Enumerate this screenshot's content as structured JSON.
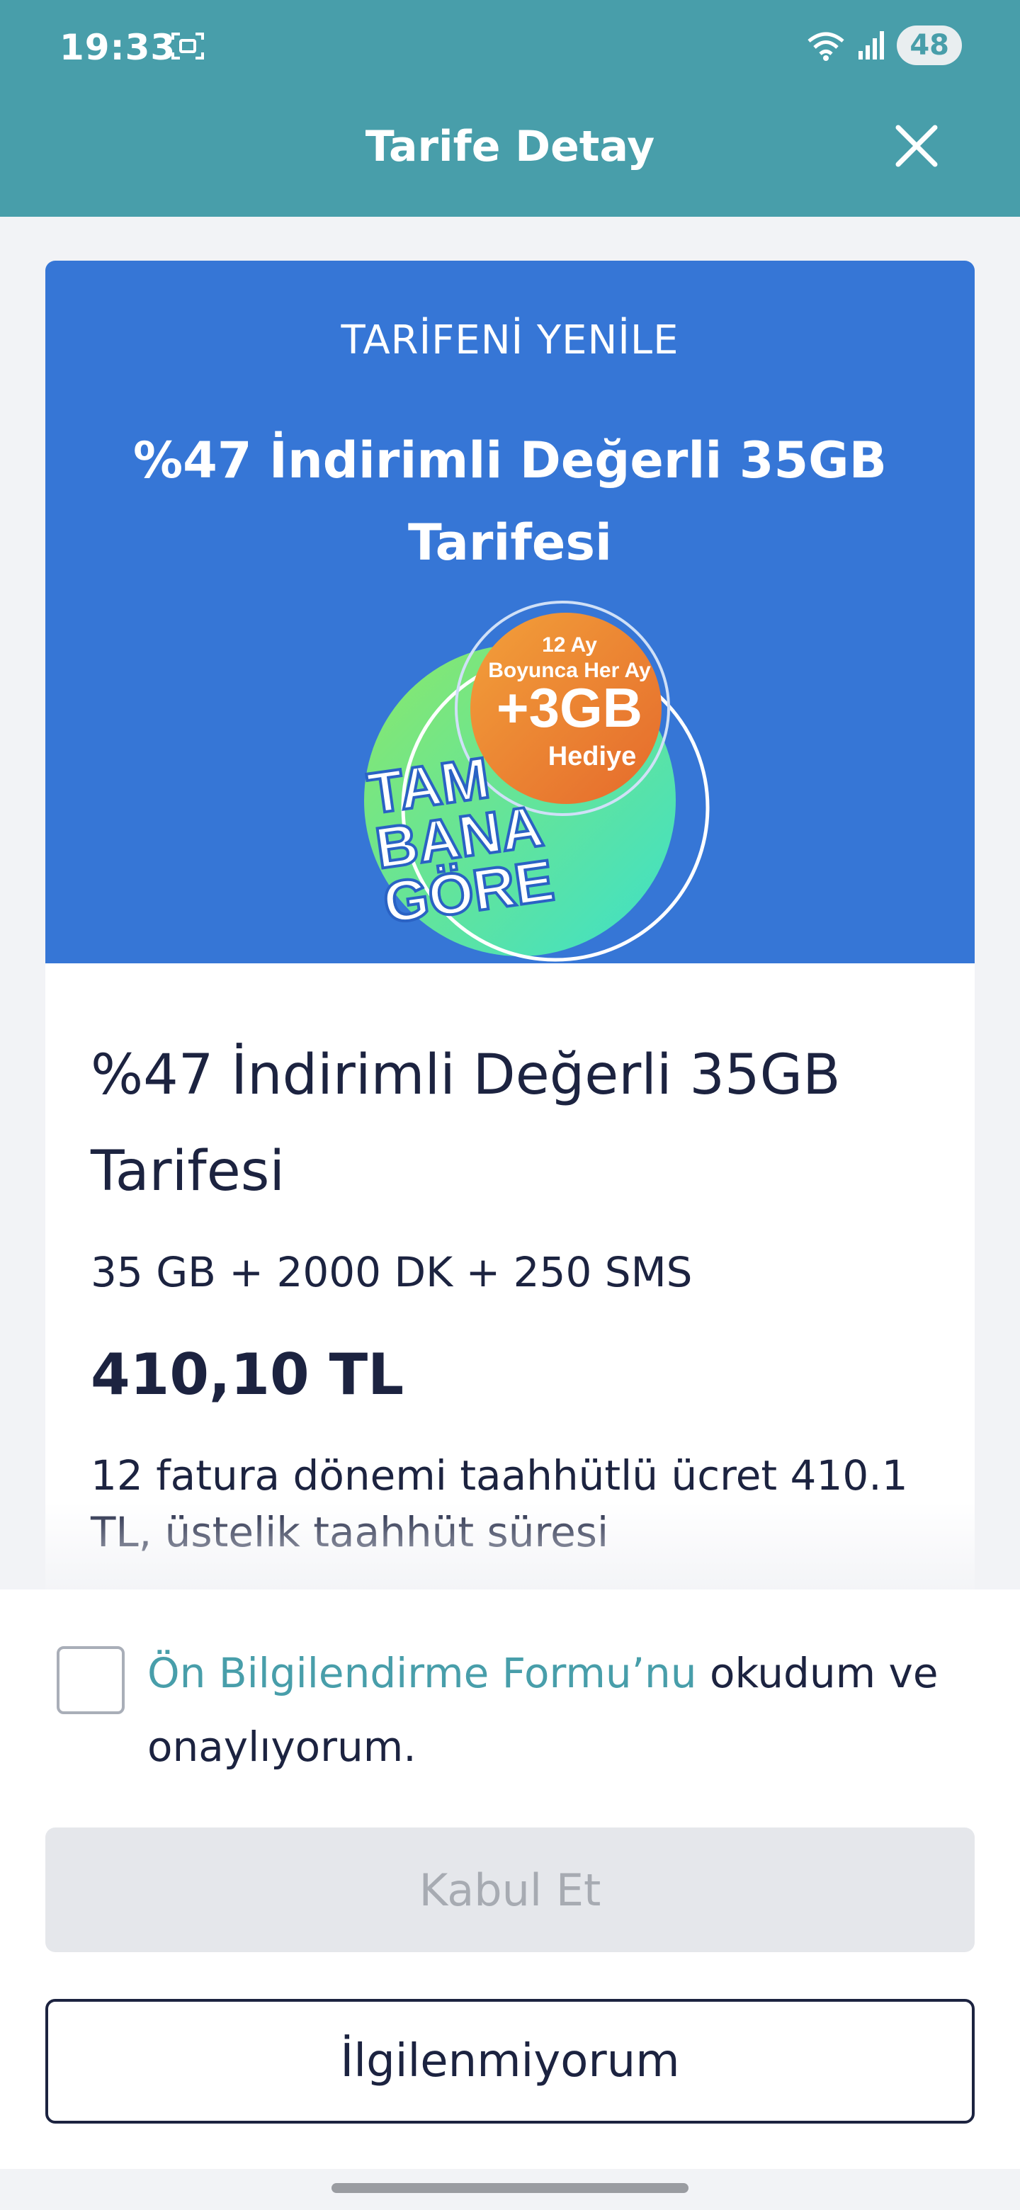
{
  "status_bar": {
    "time": "19:33",
    "battery": "48",
    "icons": [
      "screenshot-icon",
      "wifi-icon",
      "signal-icon"
    ]
  },
  "header": {
    "title": "Tarife Detay",
    "close_icon": "close-icon"
  },
  "banner": {
    "top_label": "TARİFENİ YENİLE",
    "title": "%47 İndirimli Değerli 35GB Tarifesi",
    "promo_badge": {
      "line1": "12 Ay",
      "line2": "Boyunca Her Ay",
      "amount": "+3GB",
      "line4": "Hediye",
      "brand1": "TAM",
      "brand2": "BANA",
      "brand3": "GÖRE"
    }
  },
  "package": {
    "name": "%47 İndirimli Değerli 35GB Tarifesi",
    "description": "35 GB + 2000 DK + 250 SMS",
    "price": "410,10 TL",
    "terms": "12 fatura dönemi taahhütlü ücret 410.1 TL, üstelik taahhüt süresi"
  },
  "consent": {
    "link_text": "Ön Bilgilendirme Formu’nu",
    "rest_text": " okudum ve onaylıyorum.",
    "checked": false
  },
  "buttons": {
    "accept": "Kabul Et",
    "decline": "İlgilenmiyorum"
  },
  "colors": {
    "header": "#489eaa",
    "banner": "#3676d6",
    "link": "#489eaa",
    "text": "#1c2340"
  }
}
